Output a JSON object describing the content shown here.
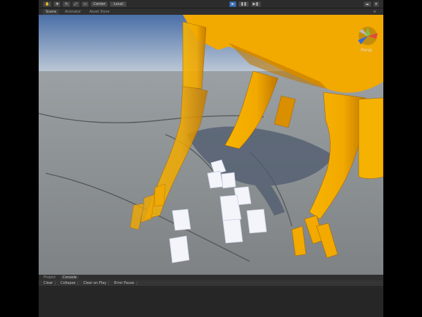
{
  "toolbar": {
    "tool_icons": [
      "hand-icon",
      "move-icon",
      "rotate-icon",
      "scale-icon",
      "rect-icon"
    ],
    "pivot_label": "Center",
    "space_label": "Local",
    "play_icons": [
      "play-icon",
      "pause-icon",
      "step-icon"
    ]
  },
  "tabs": [
    {
      "label": "Scene",
      "active": true
    },
    {
      "label": "Animator",
      "active": false
    },
    {
      "label": "Asset Store",
      "active": false
    }
  ],
  "gizmo": {
    "label": "Persp"
  },
  "bottom_tabs": [
    {
      "label": "Project",
      "active": false
    },
    {
      "label": "Console",
      "active": true
    }
  ],
  "console_buttons": [
    "Clear",
    "Collapse",
    "Clear on Play",
    "Error Pause"
  ],
  "colors": {
    "sky_top": "#4a6fa8",
    "sky_horizon": "#c9d2da",
    "ground": "#8c9092",
    "robot": "#f2a900",
    "robot_shade": "#c07800",
    "shadow": "#4e5a6e",
    "cube": "#f4f5fb"
  }
}
